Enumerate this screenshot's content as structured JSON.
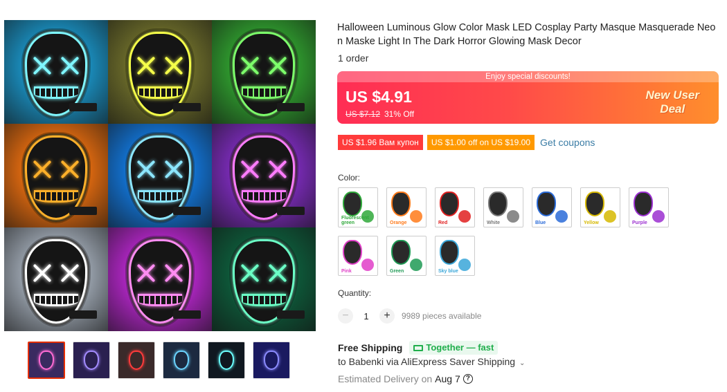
{
  "gallery": {
    "cells": [
      {
        "bg": "#1a8fc0",
        "glow": "#7ff6ff"
      },
      {
        "bg": "#6b6b2a",
        "glow": "#f5ff4a"
      },
      {
        "bg": "#2f9b2e",
        "glow": "#7dff6b"
      },
      {
        "bg": "#e06a10",
        "glow": "#ffb02a"
      },
      {
        "bg": "#1274d6",
        "glow": "#8ce6ff"
      },
      {
        "bg": "#7a2bb8",
        "glow": "#ff7dff"
      },
      {
        "bg": "#9aa3ae",
        "glow": "#ffffff"
      },
      {
        "bg": "#b126c6",
        "glow": "#ff8cf2"
      },
      {
        "bg": "#0e5a3a",
        "glow": "#6bffc6"
      }
    ],
    "thumbs": [
      {
        "glow": "#ff6bd4",
        "bg": "#3a2a60",
        "active": true
      },
      {
        "glow": "#a48cff",
        "bg": "#2a2050"
      },
      {
        "glow": "#ff3b3b",
        "bg": "#3a2a2a"
      },
      {
        "glow": "#6bd4ff",
        "bg": "#1c2a40"
      },
      {
        "glow": "#6bffff",
        "bg": "#101820"
      },
      {
        "glow": "#8c8cff",
        "bg": "#1a1a60"
      }
    ]
  },
  "product": {
    "title": "Halloween Luminous Glow Color Mask LED Cosplay Party Masque Masquerade Neon Maske Light In The Dark Horror Glowing Mask Decor",
    "orders": "1 order"
  },
  "price": {
    "discount_strip": "Enjoy special discounts!",
    "current": "US $4.91",
    "original": "US $7.12",
    "off": "31% Off",
    "new_user_line1": "New User",
    "new_user_line2": "Deal"
  },
  "coupons": {
    "coupon1": "US $1.96 Вам купон",
    "coupon2": "US $1.00 off on US $19.00",
    "get_link": "Get coupons"
  },
  "color": {
    "label": "Color:",
    "options": [
      {
        "label": "Fluorescent green",
        "color": "#2fa83a"
      },
      {
        "label": "Orange",
        "color": "#ff7a1a"
      },
      {
        "label": "Red",
        "color": "#e02020"
      },
      {
        "label": "White",
        "color": "#777777"
      },
      {
        "label": "Blue",
        "color": "#2a6bd8"
      },
      {
        "label": "Yellow",
        "color": "#d6b800"
      },
      {
        "label": "Purple",
        "color": "#9b2fd0"
      },
      {
        "label": "Pink",
        "color": "#e040c8"
      },
      {
        "label": "Green",
        "color": "#1f9a55"
      },
      {
        "label": "Sky blue",
        "color": "#3aa6d8"
      }
    ]
  },
  "quantity": {
    "label": "Quantity:",
    "value": "1",
    "available": "9989 pieces available"
  },
  "shipping": {
    "free": "Free Shipping",
    "together": "Together — fast",
    "to": "to Babenki via AliExpress Saver Shipping",
    "est_prefix": "Estimated Delivery on",
    "date": "Aug 7"
  }
}
